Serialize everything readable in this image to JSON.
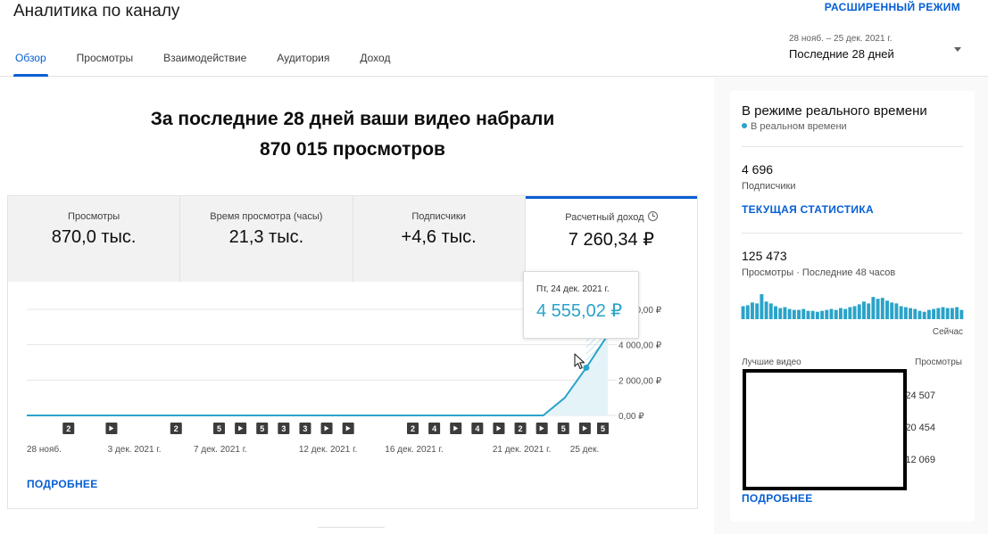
{
  "header": {
    "title": "Аналитика по каналу",
    "advanced_mode": "РАСШИРЕННЫЙ РЕЖИМ",
    "tabs": [
      "Обзор",
      "Просмотры",
      "Взаимодействие",
      "Аудитория",
      "Доход"
    ],
    "period_range": "28 нояб. – 25 дек. 2021 г.",
    "period_label": "Последние 28 дней"
  },
  "overview": {
    "headline_line1": "За последние 28 дней ваши видео набрали",
    "headline_line2": "870 015 просмотров",
    "metrics": [
      {
        "label": "Просмотры",
        "value": "870,0 тыс."
      },
      {
        "label": "Время просмотра (часы)",
        "value": "21,3 тыс."
      },
      {
        "label": "Подписчики",
        "value": "+4,6 тыс."
      },
      {
        "label": "Расчетный доход",
        "value": "7 260,34 ₽"
      }
    ],
    "more_link": "ПОДРОБНЕЕ",
    "tooltip_date": "Пт, 24 дек. 2021 г.",
    "tooltip_value": "4 555,02 ₽"
  },
  "chart_data": {
    "type": "line",
    "x": [
      "28 нояб.",
      "29 нояб.",
      "30 нояб.",
      "1 дек.",
      "2 дек.",
      "3 дек.",
      "4 дек.",
      "5 дек.",
      "6 дек.",
      "7 дек.",
      "8 дек.",
      "9 дек.",
      "10 дек.",
      "11 дек.",
      "12 дек.",
      "13 дек.",
      "14 дек.",
      "15 дек.",
      "16 дек.",
      "17 дек.",
      "18 дек.",
      "19 дек.",
      "20 дек.",
      "21 дек.",
      "22 дек.",
      "23 дек.",
      "24 дек.",
      "25 дек."
    ],
    "series": [
      {
        "values": [
          0,
          0,
          0,
          0,
          0,
          0,
          0,
          0,
          0,
          0,
          0,
          0,
          0,
          0,
          0,
          0,
          0,
          0,
          0,
          0,
          0,
          0,
          0,
          0,
          0,
          1000,
          2700,
          4555.02
        ]
      }
    ],
    "x_tick_labels": [
      "28 нояб.",
      "3 дек. 2021 г.",
      "7 дек. 2021 г.",
      "12 дек. 2021 г.",
      "16 дек. 2021 г.",
      "21 дек. 2021 г.",
      "25 дек."
    ],
    "x_tick_dates": [
      "28 нояб.",
      "3 дек.",
      "7 дек.",
      "12 дек.",
      "16 дек.",
      "21 дек.",
      "25 дек."
    ],
    "y_tick_labels": [
      "0,00 ₽",
      "2 000,00 ₽",
      "4 000,00 ₽",
      "6 000,00 ₽"
    ],
    "y_ticks": [
      0,
      2000,
      4000,
      6000
    ],
    "ylim": [
      0,
      6000
    ],
    "line_color": "#2aa3c9",
    "highlighted_point": "24 дек.",
    "hatched_region": [
      "24 дек.",
      "25 дек."
    ],
    "upload_markers": [
      {
        "day": "30 нояб.",
        "label": "2"
      },
      {
        "day": "2 дек.",
        "label": "play"
      },
      {
        "day": "5 дек.",
        "label": "2"
      },
      {
        "day": "7 дек.",
        "label": "5"
      },
      {
        "day": "8 дек.",
        "label": "play"
      },
      {
        "day": "9 дек.",
        "label": "5"
      },
      {
        "day": "10 дек.",
        "label": "3"
      },
      {
        "day": "11 дек.",
        "label": "3"
      },
      {
        "day": "12 дек.",
        "label": "play"
      },
      {
        "day": "13 дек.",
        "label": "play"
      },
      {
        "day": "16 дек.",
        "label": "2"
      },
      {
        "day": "17 дек.",
        "label": "4"
      },
      {
        "day": "18 дек.",
        "label": "play"
      },
      {
        "day": "19 дек.",
        "label": "4"
      },
      {
        "day": "20 дек.",
        "label": "play"
      },
      {
        "day": "21 дек.",
        "label": "2"
      },
      {
        "day": "22 дек.",
        "label": "play"
      },
      {
        "day": "23 дек.",
        "label": "5"
      },
      {
        "day": "24 дек.",
        "label": "play"
      },
      {
        "day": "25 дек.",
        "label": "6"
      },
      {
        "day": "25 дек.",
        "label": "5"
      }
    ]
  },
  "realtime": {
    "title": "В режиме реального времени",
    "live_label": "В реальном времени",
    "subscribers_value": "4 696",
    "subscribers_label": "Подписчики",
    "current_stats_link": "ТЕКУЩАЯ СТАТИСТИКА",
    "views_value": "125 473",
    "views_label": "Просмотры · Последние 48 часов",
    "now_label": "Сейчас",
    "hourly_views": [
      14,
      15,
      18,
      17,
      27,
      19,
      17,
      14,
      12,
      13,
      11,
      10,
      10,
      11,
      9,
      9,
      8,
      9,
      10,
      11,
      10,
      12,
      11,
      13,
      14,
      16,
      19,
      17,
      24,
      22,
      23,
      20,
      18,
      17,
      14,
      13,
      12,
      11,
      9,
      8,
      10,
      11,
      12,
      13,
      12,
      12,
      13,
      10
    ],
    "top_videos_label": "Лучшие видео",
    "top_views_label": "Просмотры",
    "top_videos": [
      {
        "views": "24 507"
      },
      {
        "views": "20 454"
      },
      {
        "views": "12 069"
      }
    ],
    "more_link": "ПОДРОБНЕЕ",
    "bar_color": "#2aa3c9"
  }
}
